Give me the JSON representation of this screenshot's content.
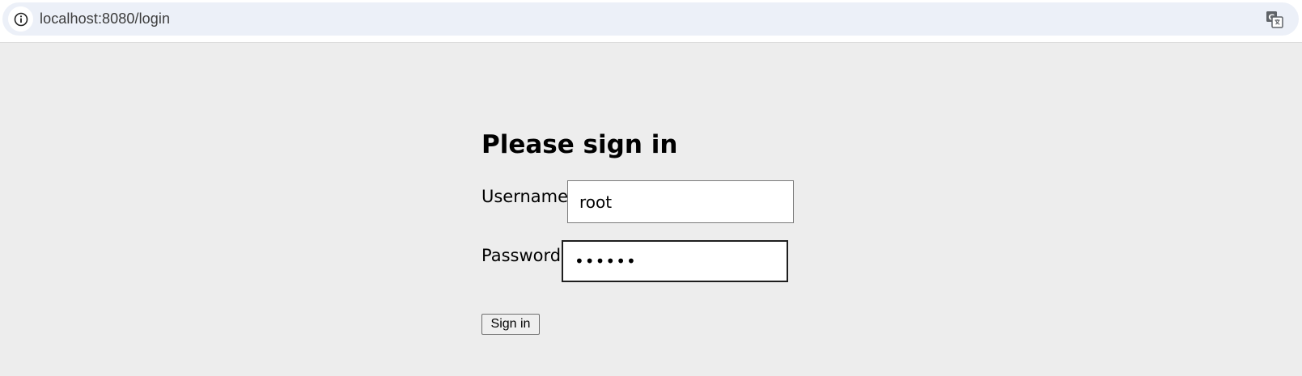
{
  "browser": {
    "url": "localhost:8080/login",
    "site_info_icon": "info-icon",
    "translate_icon": "translate-icon"
  },
  "login": {
    "title": "Please sign in",
    "username_label": "Username",
    "username_value": "root",
    "password_label": "Password",
    "password_value": "••••••",
    "submit_label": "Sign in"
  },
  "colors": {
    "page_background": "#ededed",
    "address_bar_background": "#ecf0f8"
  }
}
